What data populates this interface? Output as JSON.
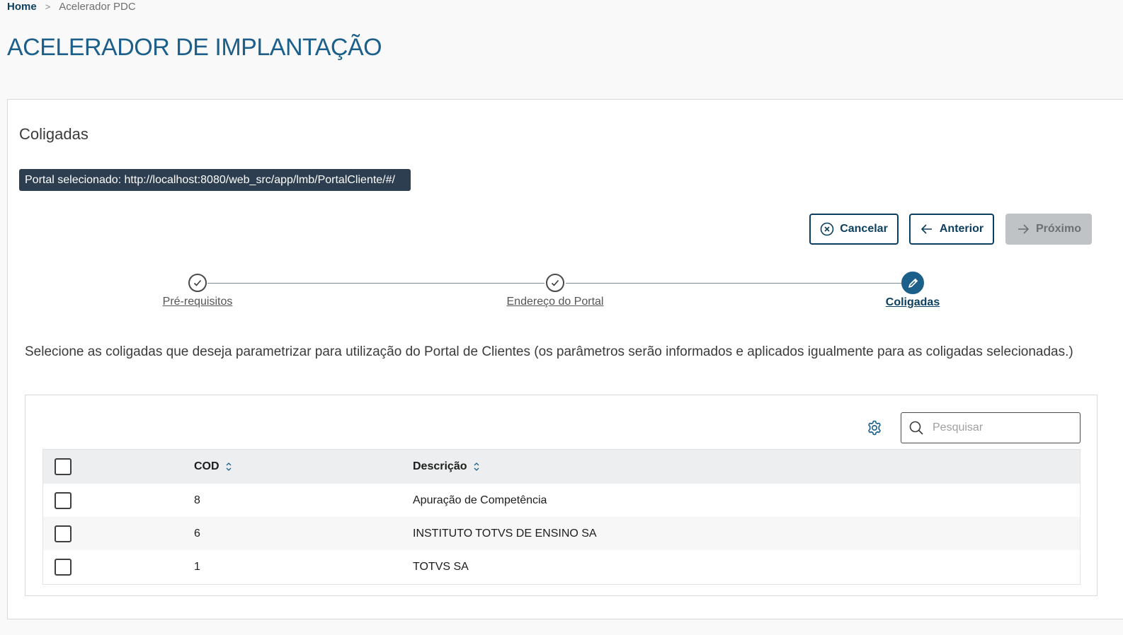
{
  "breadcrumb": {
    "home": "Home",
    "separator": ">",
    "current": "Acelerador PDC"
  },
  "page": {
    "title": "ACELERADOR DE IMPLANTAÇÃO"
  },
  "section": {
    "title": "Coligadas",
    "portal_tag": "Portal selecionado: http://localhost:8080/web_src/app/lmb/PortalCliente/#/"
  },
  "actions": {
    "cancel": "Cancelar",
    "previous": "Anterior",
    "next": "Próximo"
  },
  "stepper": {
    "steps": [
      {
        "label": "Pré-requisitos",
        "state": "done"
      },
      {
        "label": "Endereço do Portal",
        "state": "done"
      },
      {
        "label": "Coligadas",
        "state": "active"
      }
    ]
  },
  "instructions": "Selecione as coligadas que deseja parametrizar para utilização do Portal de Clientes (os parâmetros serão informados e aplicados igualmente para as coligadas selecionadas.)",
  "table": {
    "search_placeholder": "Pesquisar",
    "columns": [
      "COD",
      "Descrição"
    ],
    "rows": [
      {
        "cod": "8",
        "descricao": "Apuração de Competência"
      },
      {
        "cod": "6",
        "descricao": "INSTITUTO TOTVS DE ENSINO SA"
      },
      {
        "cod": "1",
        "descricao": "TOTVS SA"
      }
    ]
  },
  "icons": {
    "cancel": "x-circle-icon",
    "previous": "arrow-left-icon",
    "next": "arrow-right-icon",
    "settings": "gear-icon",
    "search": "search-icon",
    "step_done": "check-icon",
    "step_active": "pencil-icon",
    "sort": "sort-icon"
  },
  "colors": {
    "primary": "#0c3e5e",
    "title": "#1c5f8a",
    "tag_bg": "#2c3e50",
    "disabled": "#bfc3c5"
  }
}
